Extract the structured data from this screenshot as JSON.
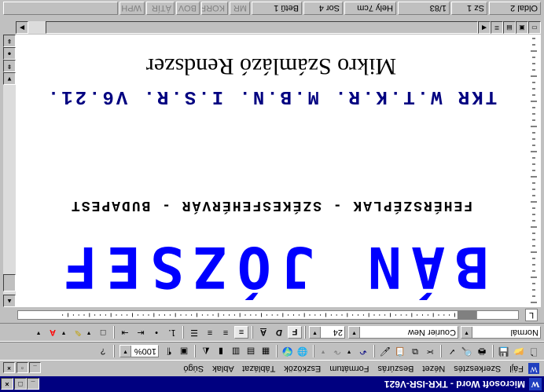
{
  "window": {
    "title": "Microsoft Word - TKR-ISR-V621"
  },
  "menu": {
    "items": [
      "Fájl",
      "Szerkesztés",
      "Nézet",
      "Beszúrás",
      "Formátum",
      "Eszközök",
      "Táblázat",
      "Ablak",
      "Súgó"
    ]
  },
  "formatting": {
    "style": "Normál",
    "font": "Courier New",
    "size": "24",
    "bold": "F",
    "italic": "D",
    "underline": "A"
  },
  "standard": {
    "zoom": "100%"
  },
  "document": {
    "name": "BÁN JÓZSEF",
    "cities": "FEHÉRSZÉPLAK - SZÉKESFEHÉRVÁR - BUDAPEST",
    "trade": "TKR W.T.K.R. M.B.N. I.S.R. V6.21.",
    "system": "Mikro Számlázó Rendszer"
  },
  "status": {
    "page": "Oldal 2",
    "section": "Sz 1",
    "pages": "1/83",
    "at": "Hely 7cm",
    "line": "Sor 4",
    "col": "Betű 1",
    "rec": "MR",
    "trk": "KORR",
    "ext": "BOV",
    "ovr": "ÁTÍR",
    "wph": "WPH"
  },
  "colors": {
    "name": "#0000ff",
    "trade": "#000080",
    "titlebar": "#000080"
  }
}
